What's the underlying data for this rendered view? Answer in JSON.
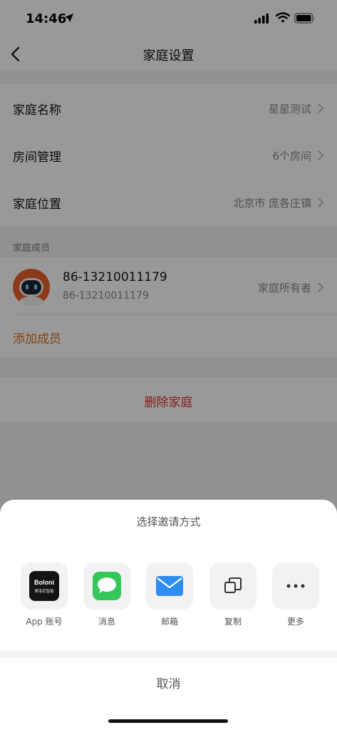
{
  "status_bar": {
    "time": "14:46"
  },
  "nav": {
    "title": "家庭设置"
  },
  "settings": [
    {
      "label": "家庭名称",
      "value": "星星测试"
    },
    {
      "label": "房间管理",
      "value": "6个房间"
    },
    {
      "label": "家庭位置",
      "value": "北京市 庞各庄镇"
    }
  ],
  "members": {
    "section_label": "家庭成员",
    "items": [
      {
        "phone": "86-13210011179",
        "sub": "86-13210011179",
        "role": "家庭所有者"
      }
    ],
    "add_label": "添加成员"
  },
  "delete_label": "删除家庭",
  "sheet": {
    "title": "选择邀请方式",
    "options": [
      {
        "label": "App 账号",
        "icon": "boloni-app-icon",
        "brand_line1": "Boloni",
        "brand_line2": "博洛尼智能"
      },
      {
        "label": "消息",
        "icon": "messages-icon"
      },
      {
        "label": "邮箱",
        "icon": "mail-icon"
      },
      {
        "label": "复制",
        "icon": "copy-icon"
      },
      {
        "label": "更多",
        "icon": "more-icon"
      }
    ],
    "cancel_label": "取消"
  },
  "colors": {
    "accent": "#e0721a",
    "danger": "#e0322c",
    "messages_green": "#34c759",
    "mail_blue": "#2f8cf0"
  }
}
